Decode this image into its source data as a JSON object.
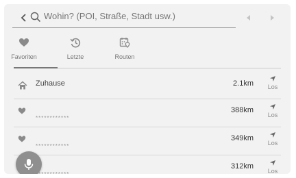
{
  "search": {
    "placeholder": "Wohin? (POI, Straße, Stadt usw.)"
  },
  "tabs": [
    {
      "label": "Favoriten",
      "icon": "heart-icon",
      "active": true
    },
    {
      "label": "Letzte",
      "icon": "history-icon",
      "active": false
    },
    {
      "label": "Routen",
      "icon": "route-icon",
      "active": false
    }
  ],
  "list": [
    {
      "title": "Zuhause",
      "subtitle": "",
      "distance": "2.1km",
      "go_label": "Los",
      "icon": "home-icon"
    },
    {
      "title": "",
      "subtitle": "************",
      "distance": "388km",
      "go_label": "Los",
      "icon": "heart-icon"
    },
    {
      "title": "",
      "subtitle": "************",
      "distance": "349km",
      "go_label": "Los",
      "icon": "heart-icon"
    },
    {
      "title": "",
      "subtitle": "************",
      "distance": "312km",
      "go_label": "Los",
      "icon": "heart-icon"
    }
  ],
  "colors": {
    "background": "#f2f2f2",
    "icon": "#8a8a8a",
    "mic_button": "#8f8f8f"
  }
}
